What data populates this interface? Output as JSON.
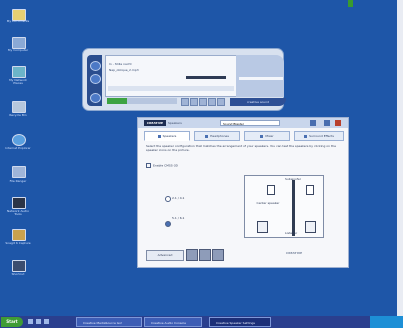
{
  "desktop": {
    "icons": [
      {
        "label": "My Documents"
      },
      {
        "label": "My Computer"
      },
      {
        "label": "My Network Places"
      },
      {
        "label": "Recycle Bin"
      },
      {
        "label": "Internet Explorer"
      },
      {
        "label": "File Ranger"
      },
      {
        "label": "Network Audio Tools"
      },
      {
        "label": "Snagit 6 Capture"
      },
      {
        "label": "Shortcut"
      }
    ]
  },
  "player": {
    "track_title": "In - Stille nacht",
    "track_info": "Nap_oblique_2.mp3",
    "brand": "creative sound"
  },
  "settings_window": {
    "logo": "CREATIVE",
    "subtitle": "Speakers",
    "search_value": "Sound Blaster",
    "tabs": [
      "Speakers",
      "Headphones",
      "Mixer",
      "Surround Effects"
    ],
    "description": "Select the speaker configuration that matches the arrangement of your speakers. You can test the speakers by clicking on the speaker icons on the picture.",
    "checkbox_label": "Enable CMSS-3D",
    "radio_options": [
      "2.1 / 4.1",
      "5.1 / 6.1"
    ],
    "diagram_labels": {
      "subwoofer": "Subwoofer",
      "center_speaker": "Center speaker",
      "listener": "Listener"
    },
    "advanced_button": "Advanced",
    "footer": "CREATIVE"
  },
  "taskbar": {
    "start": "Start",
    "tasks": [
      "Creative MediaSource Go!",
      "Creative Audio Console",
      "Creative Speaker Settings"
    ]
  }
}
